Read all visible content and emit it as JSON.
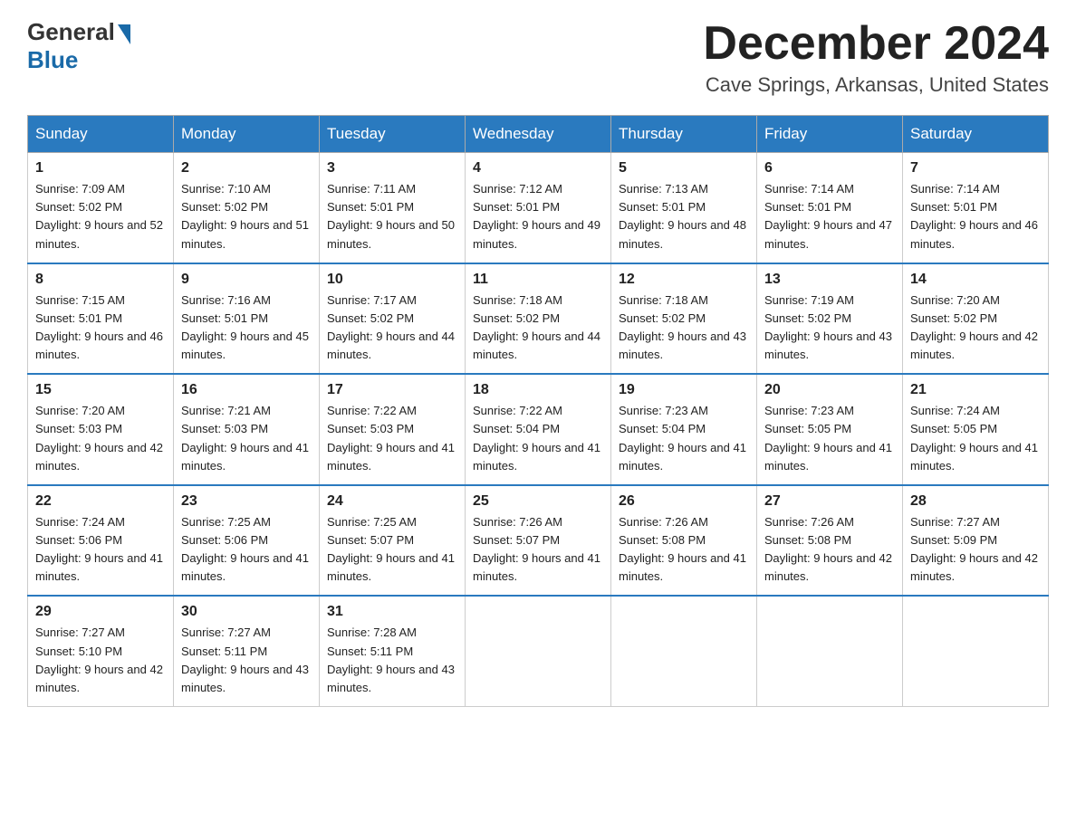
{
  "header": {
    "logo_general": "General",
    "logo_blue": "Blue",
    "title": "December 2024",
    "subtitle": "Cave Springs, Arkansas, United States"
  },
  "columns": [
    "Sunday",
    "Monday",
    "Tuesday",
    "Wednesday",
    "Thursday",
    "Friday",
    "Saturday"
  ],
  "weeks": [
    [
      {
        "day": "1",
        "sunrise": "Sunrise: 7:09 AM",
        "sunset": "Sunset: 5:02 PM",
        "daylight": "Daylight: 9 hours and 52 minutes."
      },
      {
        "day": "2",
        "sunrise": "Sunrise: 7:10 AM",
        "sunset": "Sunset: 5:02 PM",
        "daylight": "Daylight: 9 hours and 51 minutes."
      },
      {
        "day": "3",
        "sunrise": "Sunrise: 7:11 AM",
        "sunset": "Sunset: 5:01 PM",
        "daylight": "Daylight: 9 hours and 50 minutes."
      },
      {
        "day": "4",
        "sunrise": "Sunrise: 7:12 AM",
        "sunset": "Sunset: 5:01 PM",
        "daylight": "Daylight: 9 hours and 49 minutes."
      },
      {
        "day": "5",
        "sunrise": "Sunrise: 7:13 AM",
        "sunset": "Sunset: 5:01 PM",
        "daylight": "Daylight: 9 hours and 48 minutes."
      },
      {
        "day": "6",
        "sunrise": "Sunrise: 7:14 AM",
        "sunset": "Sunset: 5:01 PM",
        "daylight": "Daylight: 9 hours and 47 minutes."
      },
      {
        "day": "7",
        "sunrise": "Sunrise: 7:14 AM",
        "sunset": "Sunset: 5:01 PM",
        "daylight": "Daylight: 9 hours and 46 minutes."
      }
    ],
    [
      {
        "day": "8",
        "sunrise": "Sunrise: 7:15 AM",
        "sunset": "Sunset: 5:01 PM",
        "daylight": "Daylight: 9 hours and 46 minutes."
      },
      {
        "day": "9",
        "sunrise": "Sunrise: 7:16 AM",
        "sunset": "Sunset: 5:01 PM",
        "daylight": "Daylight: 9 hours and 45 minutes."
      },
      {
        "day": "10",
        "sunrise": "Sunrise: 7:17 AM",
        "sunset": "Sunset: 5:02 PM",
        "daylight": "Daylight: 9 hours and 44 minutes."
      },
      {
        "day": "11",
        "sunrise": "Sunrise: 7:18 AM",
        "sunset": "Sunset: 5:02 PM",
        "daylight": "Daylight: 9 hours and 44 minutes."
      },
      {
        "day": "12",
        "sunrise": "Sunrise: 7:18 AM",
        "sunset": "Sunset: 5:02 PM",
        "daylight": "Daylight: 9 hours and 43 minutes."
      },
      {
        "day": "13",
        "sunrise": "Sunrise: 7:19 AM",
        "sunset": "Sunset: 5:02 PM",
        "daylight": "Daylight: 9 hours and 43 minutes."
      },
      {
        "day": "14",
        "sunrise": "Sunrise: 7:20 AM",
        "sunset": "Sunset: 5:02 PM",
        "daylight": "Daylight: 9 hours and 42 minutes."
      }
    ],
    [
      {
        "day": "15",
        "sunrise": "Sunrise: 7:20 AM",
        "sunset": "Sunset: 5:03 PM",
        "daylight": "Daylight: 9 hours and 42 minutes."
      },
      {
        "day": "16",
        "sunrise": "Sunrise: 7:21 AM",
        "sunset": "Sunset: 5:03 PM",
        "daylight": "Daylight: 9 hours and 41 minutes."
      },
      {
        "day": "17",
        "sunrise": "Sunrise: 7:22 AM",
        "sunset": "Sunset: 5:03 PM",
        "daylight": "Daylight: 9 hours and 41 minutes."
      },
      {
        "day": "18",
        "sunrise": "Sunrise: 7:22 AM",
        "sunset": "Sunset: 5:04 PM",
        "daylight": "Daylight: 9 hours and 41 minutes."
      },
      {
        "day": "19",
        "sunrise": "Sunrise: 7:23 AM",
        "sunset": "Sunset: 5:04 PM",
        "daylight": "Daylight: 9 hours and 41 minutes."
      },
      {
        "day": "20",
        "sunrise": "Sunrise: 7:23 AM",
        "sunset": "Sunset: 5:05 PM",
        "daylight": "Daylight: 9 hours and 41 minutes."
      },
      {
        "day": "21",
        "sunrise": "Sunrise: 7:24 AM",
        "sunset": "Sunset: 5:05 PM",
        "daylight": "Daylight: 9 hours and 41 minutes."
      }
    ],
    [
      {
        "day": "22",
        "sunrise": "Sunrise: 7:24 AM",
        "sunset": "Sunset: 5:06 PM",
        "daylight": "Daylight: 9 hours and 41 minutes."
      },
      {
        "day": "23",
        "sunrise": "Sunrise: 7:25 AM",
        "sunset": "Sunset: 5:06 PM",
        "daylight": "Daylight: 9 hours and 41 minutes."
      },
      {
        "day": "24",
        "sunrise": "Sunrise: 7:25 AM",
        "sunset": "Sunset: 5:07 PM",
        "daylight": "Daylight: 9 hours and 41 minutes."
      },
      {
        "day": "25",
        "sunrise": "Sunrise: 7:26 AM",
        "sunset": "Sunset: 5:07 PM",
        "daylight": "Daylight: 9 hours and 41 minutes."
      },
      {
        "day": "26",
        "sunrise": "Sunrise: 7:26 AM",
        "sunset": "Sunset: 5:08 PM",
        "daylight": "Daylight: 9 hours and 41 minutes."
      },
      {
        "day": "27",
        "sunrise": "Sunrise: 7:26 AM",
        "sunset": "Sunset: 5:08 PM",
        "daylight": "Daylight: 9 hours and 42 minutes."
      },
      {
        "day": "28",
        "sunrise": "Sunrise: 7:27 AM",
        "sunset": "Sunset: 5:09 PM",
        "daylight": "Daylight: 9 hours and 42 minutes."
      }
    ],
    [
      {
        "day": "29",
        "sunrise": "Sunrise: 7:27 AM",
        "sunset": "Sunset: 5:10 PM",
        "daylight": "Daylight: 9 hours and 42 minutes."
      },
      {
        "day": "30",
        "sunrise": "Sunrise: 7:27 AM",
        "sunset": "Sunset: 5:11 PM",
        "daylight": "Daylight: 9 hours and 43 minutes."
      },
      {
        "day": "31",
        "sunrise": "Sunrise: 7:28 AM",
        "sunset": "Sunset: 5:11 PM",
        "daylight": "Daylight: 9 hours and 43 minutes."
      },
      {
        "day": "",
        "sunrise": "",
        "sunset": "",
        "daylight": ""
      },
      {
        "day": "",
        "sunrise": "",
        "sunset": "",
        "daylight": ""
      },
      {
        "day": "",
        "sunrise": "",
        "sunset": "",
        "daylight": ""
      },
      {
        "day": "",
        "sunrise": "",
        "sunset": "",
        "daylight": ""
      }
    ]
  ]
}
